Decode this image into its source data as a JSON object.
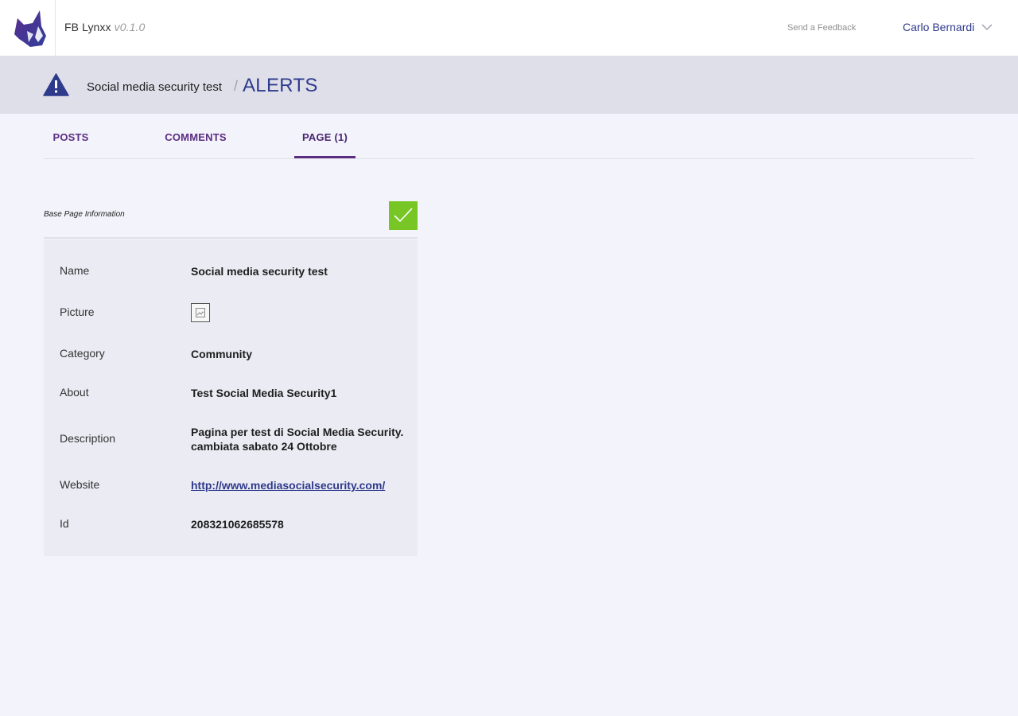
{
  "app": {
    "name": "FB Lynxx",
    "version": "v0.1.0"
  },
  "topbar": {
    "feedback": "Send a Feedback",
    "user_name": "Carlo Bernardi"
  },
  "header": {
    "breadcrumb": "Social media security test",
    "separator": "/",
    "current": "ALERTS"
  },
  "tabs": [
    {
      "label": "POSTS",
      "active": false
    },
    {
      "label": "COMMENTS",
      "active": false
    },
    {
      "label": "PAGE (1)",
      "active": true
    }
  ],
  "card": {
    "title": "Base Page Information",
    "rows": [
      {
        "label": "Name",
        "value": "Social media security test"
      },
      {
        "label": "Picture",
        "value": ""
      },
      {
        "label": "Category",
        "value": "Community"
      },
      {
        "label": "About",
        "value": "Test Social Media Security1"
      },
      {
        "label": "Description",
        "value": "Pagina per test di Social Media Security. cambiata sabato 24 Ottobre"
      },
      {
        "label": "Website",
        "value": "http://www.mediasocialsecurity.com/"
      },
      {
        "label": "Id",
        "value": "208321062685578"
      }
    ]
  },
  "colors": {
    "accent": "#2e3a8c",
    "tab": "#5a2d82",
    "success": "#78c526",
    "logo": "#4b2a8a"
  },
  "icons": {
    "logo": "lynx-logo-icon",
    "alert": "warning-icon",
    "dropdown": "chevron-down-icon",
    "check": "check-icon",
    "picture": "broken-image-icon"
  }
}
